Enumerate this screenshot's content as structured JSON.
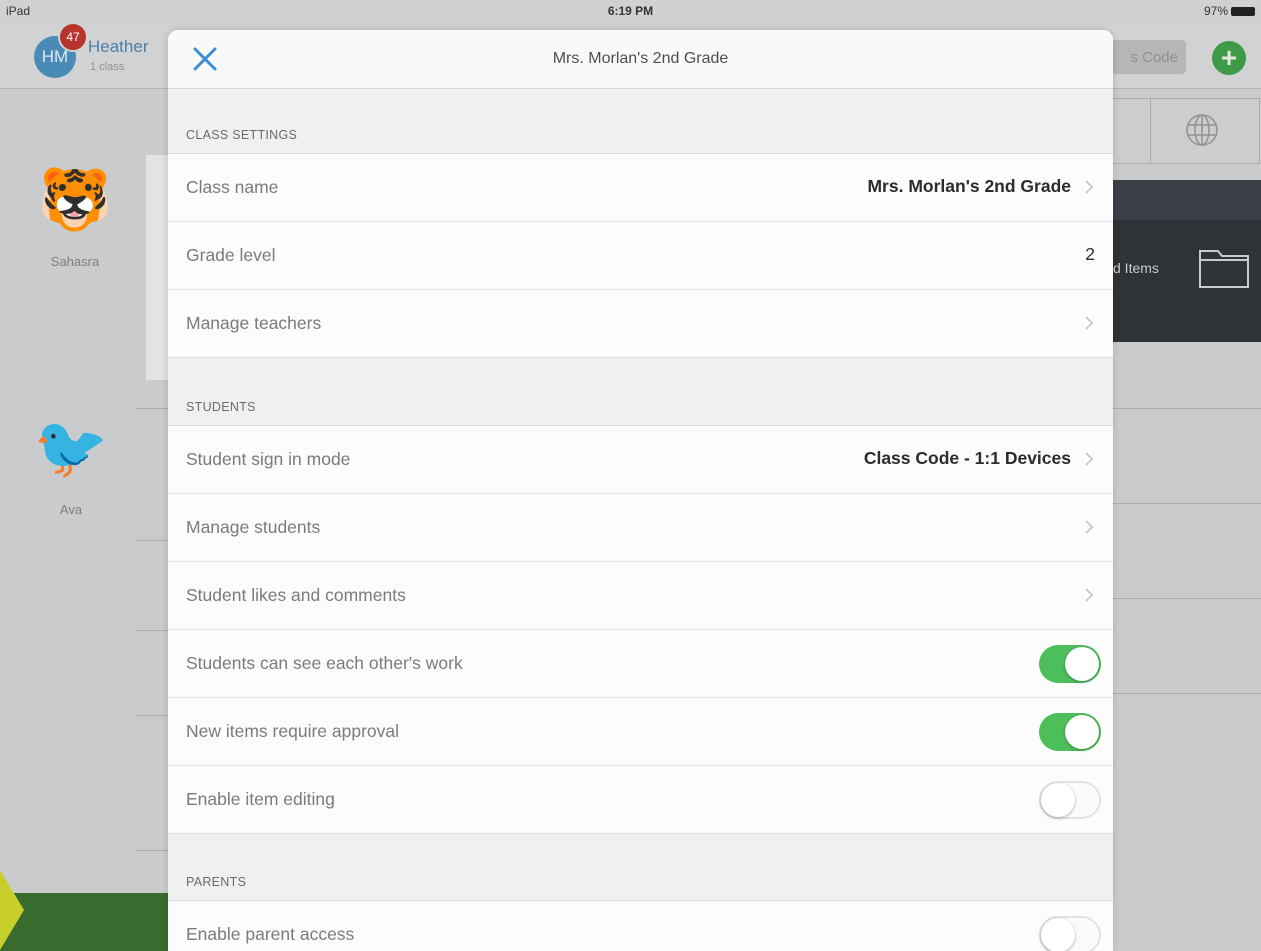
{
  "status_bar": {
    "carrier": "iPad",
    "time": "6:19 PM",
    "battery": "97%"
  },
  "background": {
    "avatar_initials": "HM",
    "notification_count": "47",
    "teacher_name": "Heather",
    "class_count": "1 class",
    "code_button_label": "s Code",
    "add_button_symbol": "+",
    "items_label": "d Items",
    "students": [
      {
        "name": "Sahasra",
        "emoji": "🐯"
      },
      {
        "name": "Ava",
        "emoji": "🐦"
      }
    ],
    "colors": {
      "add_button": "#3f9a48",
      "dark_band": "#2e3338"
    }
  },
  "modal": {
    "title": "Mrs. Morlan's 2nd Grade",
    "close_icon": "close-icon",
    "sections": {
      "class_settings": {
        "label": "CLASS SETTINGS",
        "rows": {
          "class_name": {
            "label": "Class name",
            "value": "Mrs. Morlan's 2nd Grade"
          },
          "grade_level": {
            "label": "Grade level",
            "value": "2"
          },
          "manage_teachers": {
            "label": "Manage teachers"
          }
        }
      },
      "students": {
        "label": "STUDENTS",
        "rows": {
          "sign_in_mode": {
            "label": "Student sign in mode",
            "value": "Class Code - 1:1 Devices"
          },
          "manage_students": {
            "label": "Manage students"
          },
          "likes_comments": {
            "label": "Student likes and comments"
          },
          "see_work": {
            "label": "Students can see each other's work",
            "enabled": true
          },
          "require_approval": {
            "label": "New items require approval",
            "enabled": true
          },
          "item_editing": {
            "label": "Enable item editing",
            "enabled": false
          }
        }
      },
      "parents": {
        "label": "PARENTS",
        "rows": {
          "parent_access": {
            "label": "Enable parent access",
            "enabled": false
          }
        }
      }
    },
    "colors": {
      "toggle_on": "#4cbe5a",
      "close_icon": "#3a8fd6"
    }
  }
}
